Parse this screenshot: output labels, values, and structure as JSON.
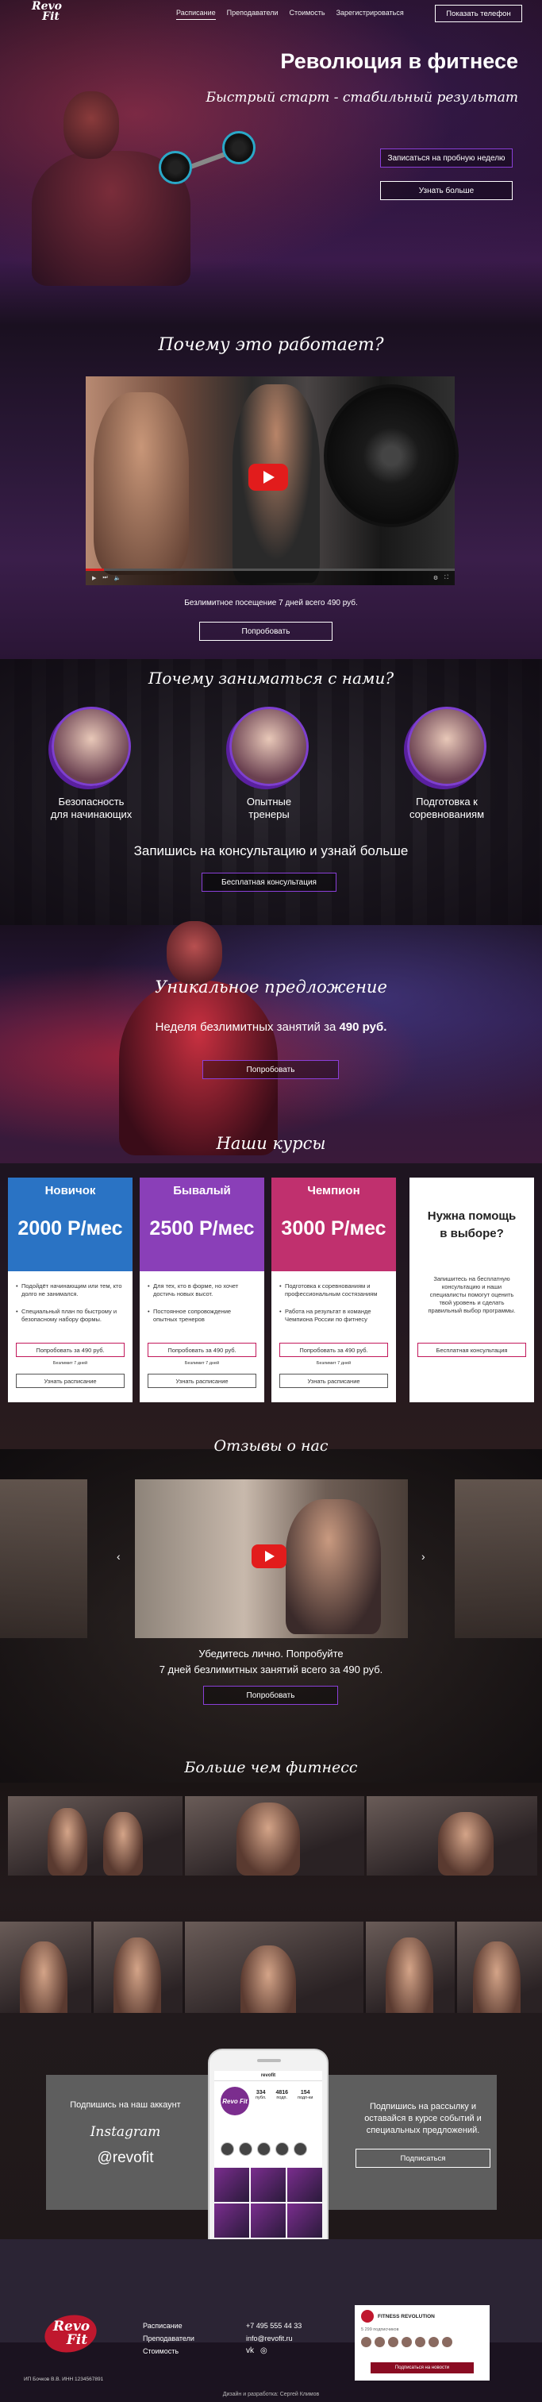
{
  "header": {
    "logo_line1": "Revo",
    "logo_line2": "Fit",
    "nav": [
      "Расписание",
      "Преподаватели",
      "Стоимость",
      "Зарегистрироваться"
    ],
    "phone_button": "Показать телефон"
  },
  "hero": {
    "title": "Революция в фитнесе",
    "subtitle": "Быстрый старт - стабильный результат",
    "btn_trial": "Записаться на пробную неделю",
    "btn_more": "Узнать больше"
  },
  "why": {
    "title": "Почему это работает?",
    "text": "Безлимитное посещение 7 дней  всего 490 руб.",
    "btn": "Попробовать"
  },
  "reasons": {
    "title": "Почему заниматься с нами?",
    "items": [
      {
        "line1": "Безопасность",
        "line2": "для начинающих"
      },
      {
        "line1": "Опытные",
        "line2": "тренеры"
      },
      {
        "line1": "Подготовка к",
        "line2": "соревнованиям"
      }
    ],
    "consult_text": "Запишись на консультацию и узнай больше",
    "consult_btn": "Бесплатная консультация"
  },
  "offer": {
    "title": "Уникальное предложение",
    "text": "Неделя безлимитных занятий за ",
    "price": "490 руб.",
    "btn": "Попробовать"
  },
  "courses": {
    "title": "Наши курсы",
    "cards": [
      {
        "name": "Новичок",
        "price": "2000 Р/мес",
        "color": "#2a73c4",
        "features": [
          "Подойдёт начинающим или тем, кто долго не занимался.",
          "Специальный план по быстрому и безопасному набору формы."
        ],
        "btn1": "Попробовать за 490 руб.",
        "note": "Безлимит 7 дней",
        "btn2": "Узнать расписание"
      },
      {
        "name": "Бывалый",
        "price": "2500 Р/мес",
        "color": "#8a3fb8",
        "features": [
          "Для тех, кто в форме, но хочет достичь новых высот.",
          "Постоянное сопровождение опытных тренеров"
        ],
        "btn1": "Попробовать за 490 руб.",
        "note": "Безлимит 7 дней",
        "btn2": "Узнать расписание"
      },
      {
        "name": "Чемпион",
        "price": "3000 Р/мес",
        "color": "#c0306e",
        "features": [
          "Подготовка к соревнованиям и профессиональным состязаниям",
          "Работа на результат в команде Чемпиона России по фитнесу"
        ],
        "btn1": "Попробовать за 490 руб.",
        "note": "Безлимит 7 дней",
        "btn2": "Узнать расписание"
      }
    ],
    "help": {
      "title_line1": "Нужна помощь",
      "title_line2": "в выборе?",
      "desc": "Запишитесь на бесплатную консультацию и наши специалисты помогут оценить твой уровень и сделать правильный выбор программы.",
      "btn": "Бесплатная консультация"
    }
  },
  "reviews": {
    "title": "Отзывы о нас",
    "arrow_left": "‹",
    "arrow_right": "›",
    "text_line1": "Убедитесь лично. Попробуйте",
    "text_line2": "7 дней безлимитных занятий всего за 490 руб.",
    "btn": "Попробовать"
  },
  "more": {
    "title": "Больше чем фитнесс"
  },
  "insta": {
    "left_text": "Подпишись на наш аккаунт",
    "platform": "Instagram",
    "handle": "@revofit",
    "phone_username": "revofit",
    "phone_logo": "Revo Fit",
    "stats": [
      {
        "num": "334",
        "label": "публ."
      },
      {
        "num": "4816",
        "label": "подп."
      },
      {
        "num": "154",
        "label": "подп-ки"
      }
    ],
    "right_text": "Подпишись на рассылку и оставайся в курсе событий и специальных предложений.",
    "subscribe_btn": "Подписаться"
  },
  "footer": {
    "logo_line1": "Revo",
    "logo_line2": "Fit",
    "links": [
      "Расписание",
      "Преподаватели",
      "Стоимость"
    ],
    "phone": "+7 495 555 44 33",
    "email": "info@revofit.ru",
    "legal": "ИП Бочков В.В.    ИНН 1234567891",
    "credit": "Дизайн и разработка: Сергей Климов",
    "vk_name": "FITNESS REVOLUTION",
    "vk_sub": "5 299 подписчиков",
    "vk_btn": "Подписаться на новости"
  }
}
